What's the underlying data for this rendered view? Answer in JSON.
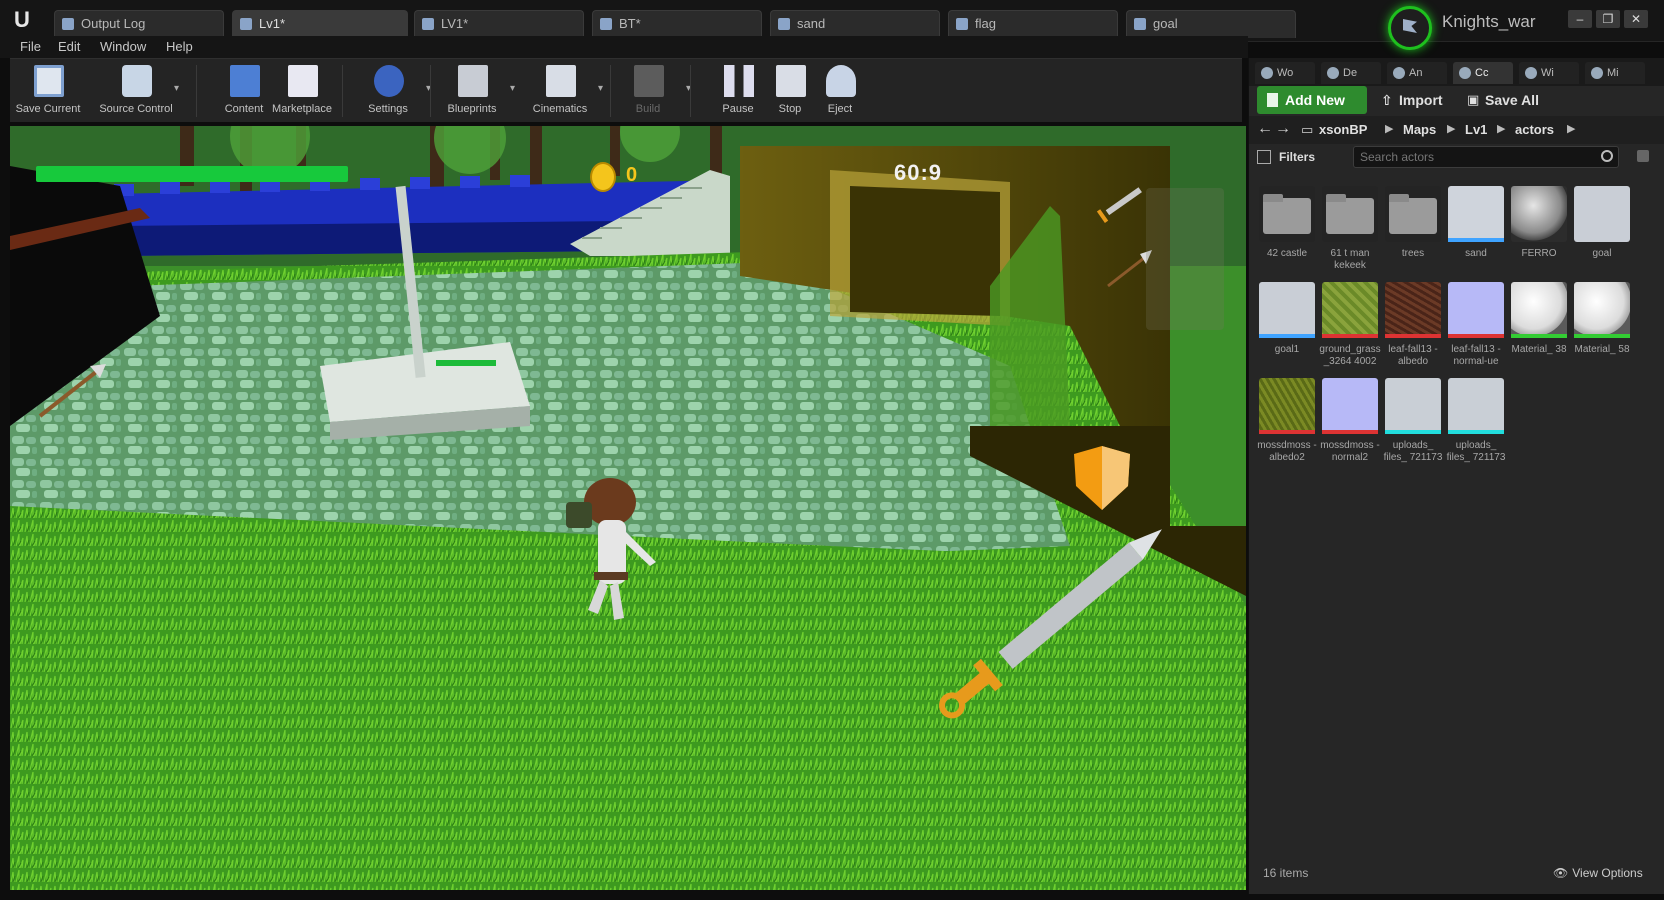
{
  "window": {
    "tabs": [
      {
        "label": "Output Log",
        "active": false
      },
      {
        "label": "Lv1*",
        "active": true
      },
      {
        "label": "LV1*",
        "active": false
      },
      {
        "label": "BT*",
        "active": false
      },
      {
        "label": "sand",
        "active": false
      },
      {
        "label": "flag",
        "active": false
      },
      {
        "label": "goal",
        "active": false
      }
    ],
    "project_name": "Knights_war",
    "controls": [
      "–",
      "❐",
      "✕"
    ]
  },
  "menu": [
    "File",
    "Edit",
    "Window",
    "Help"
  ],
  "toolbar": {
    "items": [
      {
        "label": "Save Current",
        "icon": "save-icon",
        "dropdown": false
      },
      {
        "label": "Source Control",
        "icon": "source-control-icon",
        "dropdown": true
      },
      {
        "label": "Content",
        "icon": "content-icon",
        "dropdown": false
      },
      {
        "label": "Marketplace",
        "icon": "marketplace-icon",
        "dropdown": false
      },
      {
        "label": "Settings",
        "icon": "settings-icon",
        "dropdown": true
      },
      {
        "label": "Blueprints",
        "icon": "blueprints-icon",
        "dropdown": true
      },
      {
        "label": "Cinematics",
        "icon": "cinematics-icon",
        "dropdown": true
      },
      {
        "label": "Build",
        "icon": "build-icon",
        "dropdown": true,
        "disabled": true
      },
      {
        "label": "Pause",
        "icon": "pause-icon",
        "dropdown": false
      },
      {
        "label": "Stop",
        "icon": "stop-icon",
        "dropdown": false
      },
      {
        "label": "Eject",
        "icon": "eject-icon",
        "dropdown": false
      }
    ]
  },
  "game_hud": {
    "coins": "0",
    "timer": "60:9",
    "health_fraction": 1.0,
    "colors": {
      "health": "#17c93c",
      "coin": "#f4c51c",
      "shield": "#f39c12"
    }
  },
  "content_browser": {
    "panel_tabs": [
      "Wo",
      "De",
      "An",
      "Cc",
      "Wi",
      "Mi"
    ],
    "add_new": "Add New",
    "import": "Import",
    "save_all": "Save All",
    "path": [
      "xsonBP",
      "Maps",
      "Lv1",
      "actors"
    ],
    "filters": "Filters",
    "search_placeholder": "Search actors",
    "assets": [
      {
        "name": "42 castle",
        "kind": "folder",
        "stripe": ""
      },
      {
        "name": "61 t man kekeek",
        "kind": "folder",
        "stripe": ""
      },
      {
        "name": "trees",
        "kind": "folder",
        "stripe": ""
      },
      {
        "name": "sand",
        "kind": "blueprint",
        "stripe": "#3fa3ff"
      },
      {
        "name": "FERRO",
        "kind": "sphere",
        "stripe": ""
      },
      {
        "name": "goal",
        "kind": "level",
        "stripe": ""
      },
      {
        "name": "goal1",
        "kind": "level",
        "stripe": "#3fa3ff"
      },
      {
        "name": "ground_grass_3264 4002",
        "kind": "texture-grass",
        "stripe": "#d33"
      },
      {
        "name": "leaf-fall13 -albedo",
        "kind": "texture-dirt",
        "stripe": "#d33"
      },
      {
        "name": "leaf-fall13 -normal-ue",
        "kind": "texture-normal",
        "stripe": "#d33"
      },
      {
        "name": "Material_ 38",
        "kind": "sphere-white",
        "stripe": "#3c3"
      },
      {
        "name": "Material_ 58",
        "kind": "sphere-white",
        "stripe": "#3c3"
      },
      {
        "name": "mossdmoss -albedo2",
        "kind": "texture-moss",
        "stripe": "#d33"
      },
      {
        "name": "mossdmoss -normal2",
        "kind": "texture-normal",
        "stripe": "#d33"
      },
      {
        "name": "uploads_ files_ 721173",
        "kind": "mesh",
        "stripe": "#2dd"
      },
      {
        "name": "uploads_ files_ 721173",
        "kind": "mesh",
        "stripe": "#2dd"
      }
    ],
    "item_count": "16 items",
    "view_options": "View Options"
  }
}
